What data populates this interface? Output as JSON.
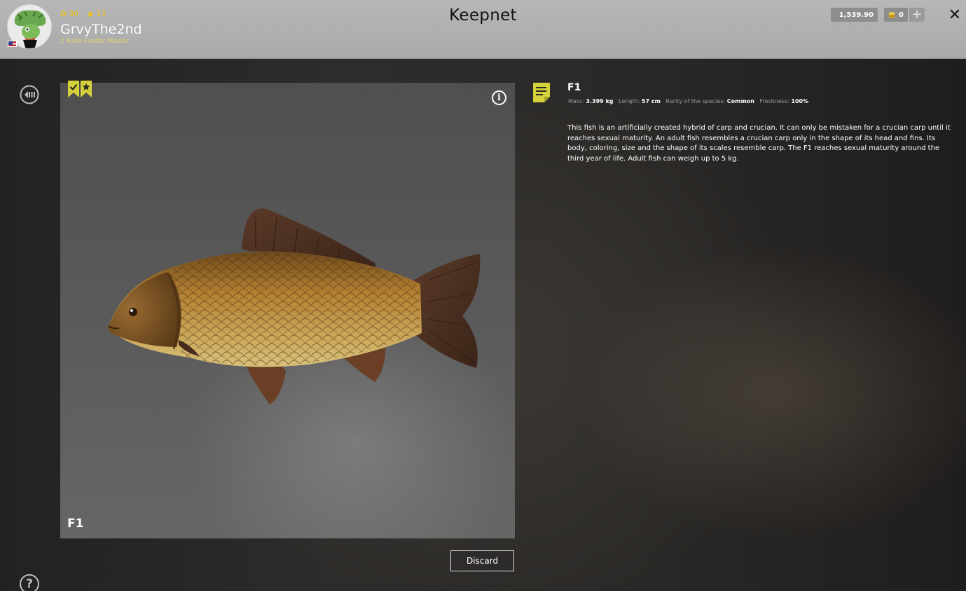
{
  "header": {
    "title": "Keepnet",
    "player": {
      "name": "GrvyThe2nd",
      "rank": "2 Rank Feeder Master",
      "stat_1": "30",
      "stat_2": "13"
    },
    "currency": {
      "silver": "1,539.90",
      "gold": "0"
    },
    "add_label": "+",
    "close_label": "✕"
  },
  "viewer": {
    "fish_label": "F1",
    "info_label": "i",
    "discard_label": "Discard"
  },
  "help_label": "?",
  "details": {
    "name": "F1",
    "stats": [
      {
        "label": "Mass:",
        "value": "3.399 kg"
      },
      {
        "label": "Length:",
        "value": "57 cm"
      },
      {
        "label": "Rarity of the species:",
        "value": "Common"
      },
      {
        "label": "Freshness:",
        "value": "100%"
      }
    ],
    "description": "This fish is an artificially created hybrid of carp and crucian. It can only be mistaken for a crucian carp until it reaches sexual maturity. An adult fish resembles a crucian carp only in the shape of its head and fins. Its body, coloring, size and the shape of its scales resemble carp. The F1 reaches sexual maturity around the third year of life. Adult fish can weigh up to 5 kg."
  },
  "colors": {
    "accent": "#d4d13a",
    "topbar": "#b1b1b1",
    "gold_text": "#f1c40f"
  }
}
